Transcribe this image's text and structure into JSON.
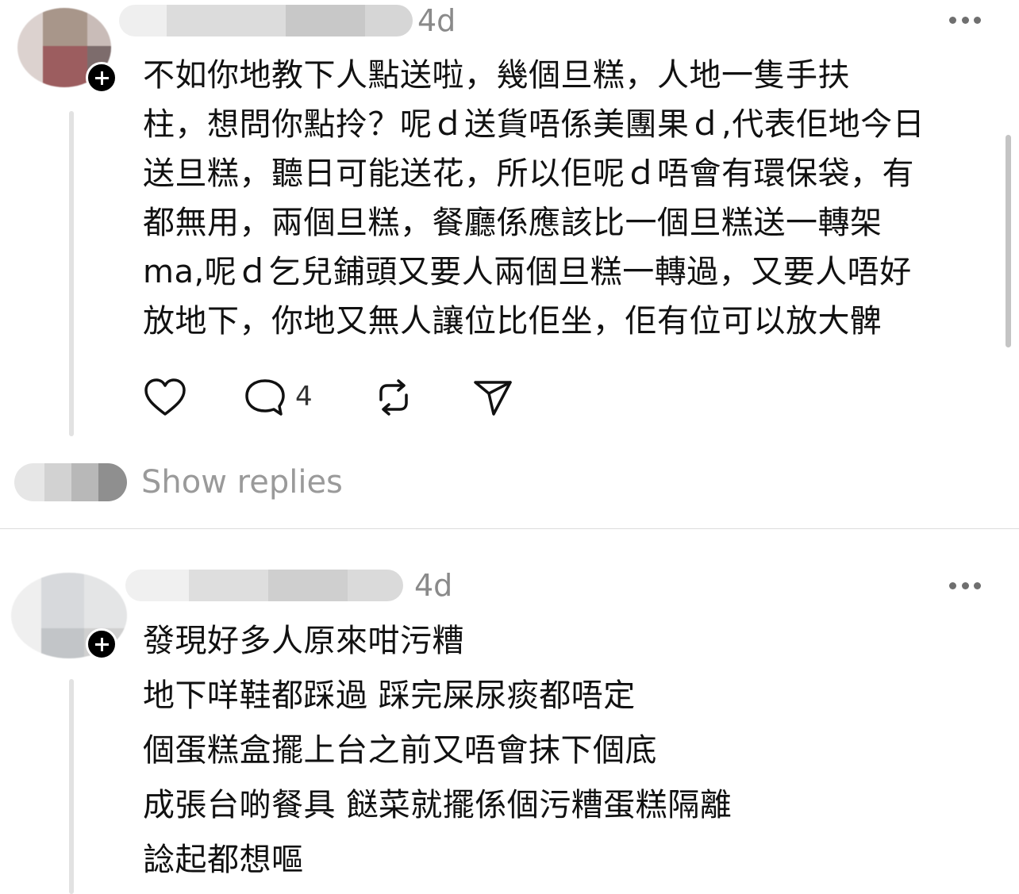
{
  "posts": [
    {
      "time": "4d",
      "text_lines": [
        "不如你地教下人點送啦，幾個旦糕，人地一隻手扶",
        "柱，想問你點拎？呢ｄ送貨唔係美團果ｄ,代表佢地今日",
        "送旦糕，聽日可能送花，所以佢呢ｄ唔會有環保袋，有",
        "都無用，兩個旦糕，餐廳係應該比一個旦糕送一轉架",
        " ma,呢ｄ乞兒鋪頭又要人兩個旦糕一轉過，又要人唔好",
        "放地下，你地又無人讓位比佢坐，佢有位可以放大髀"
      ],
      "reply_count": "4",
      "show_replies_label": "Show replies"
    },
    {
      "time": "4d",
      "text_lines": [
        "發現好多人原來咁污糟",
        "地下咩鞋都踩過 踩完屎尿痰都唔定",
        "個蛋糕盒擺上台之前又唔會抹下個底",
        "成張台啲餐具 餸菜就擺係個污糟蛋糕隔離",
        "諗起都想嘔"
      ]
    }
  ],
  "icons": {
    "more": "more-horizontal-icon",
    "like": "heart-icon",
    "reply": "comment-bubble-icon",
    "repost": "repost-icon",
    "share": "send-paper-plane-icon",
    "follow": "plus-icon"
  },
  "colors": {
    "text": "#111111",
    "muted": "#8a8a8a",
    "thread_line": "#e2e2e2",
    "background": "#ffffff"
  }
}
